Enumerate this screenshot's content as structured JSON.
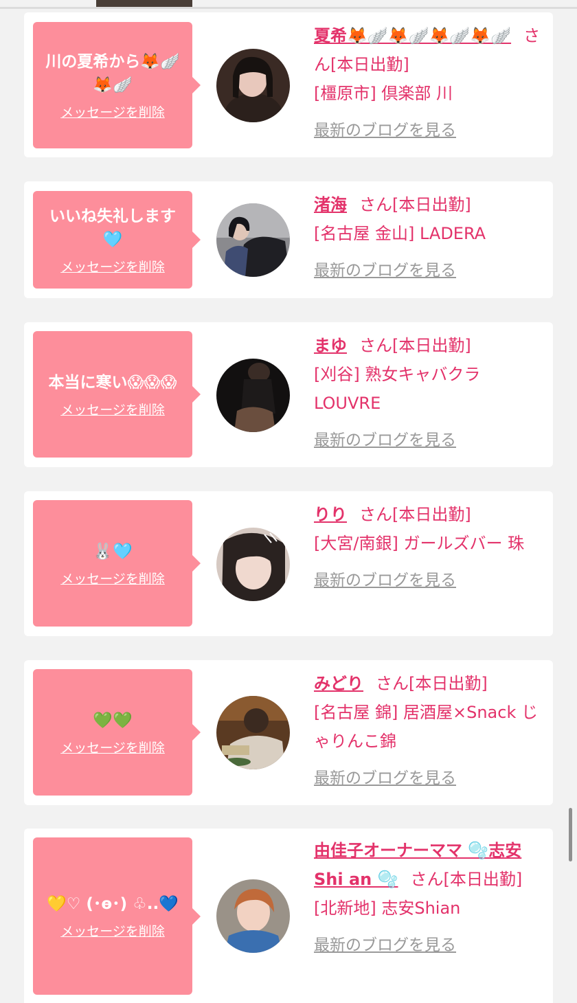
{
  "cards": [
    {
      "message": "川の夏希から🦊🪽🦊🪽",
      "delete_label": "メッセージを削除",
      "name": "夏希🦊🪽🦊🪽🦊🪽🦊🪽",
      "san_status": "さん[本日出勤]",
      "shop": "[橿原市] 倶楽部 川",
      "blog_label": "最新のブログを見る"
    },
    {
      "message": "いいね失礼します🩵",
      "delete_label": "メッセージを削除",
      "name": "渚海",
      "san_status": "さん[本日出勤]",
      "shop": "[名古屋 金山] LADERA",
      "blog_label": "最新のブログを見る"
    },
    {
      "message": "本当に寒い😱😱😱",
      "delete_label": "メッセージを削除",
      "name": "まゆ",
      "san_status": "さん[本日出勤]",
      "shop": "[刈谷] 熟女キャバクラ LOUVRE",
      "blog_label": "最新のブログを見る"
    },
    {
      "message": "🐰🩵",
      "delete_label": "メッセージを削除",
      "name": "りり",
      "san_status": "さん[本日出勤]",
      "shop": "[大宮/南銀] ガールズバー 珠",
      "blog_label": "最新のブログを見る"
    },
    {
      "message": "💚💚",
      "delete_label": "メッセージを削除",
      "name": "みどり",
      "san_status": "さん[本日出勤]",
      "shop": "[名古屋 錦] 居酒屋×Snack じゃりんこ錦",
      "blog_label": "最新のブログを見る"
    },
    {
      "message": "💛♡ (･ө･) ♧..💙",
      "delete_label": "メッセージを削除",
      "name": "由佳子オーナーママ 🫧志安 Shi an 🫧",
      "san_status": "さん[本日出勤]",
      "shop": "[北新地] 志安Shian",
      "blog_label": "最新のブログを見る"
    }
  ]
}
